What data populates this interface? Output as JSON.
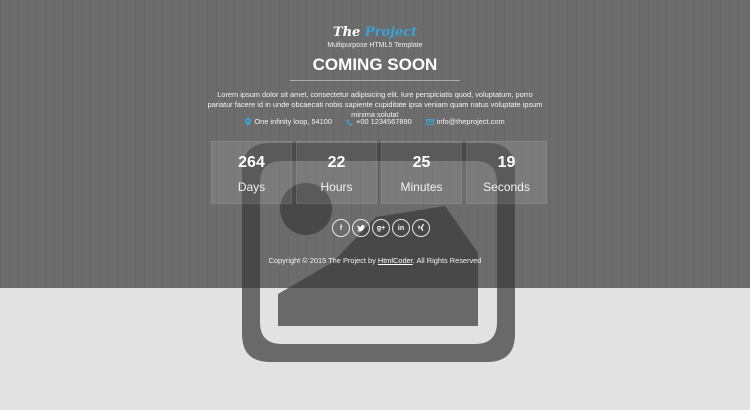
{
  "logo": {
    "part1": "The",
    "part2": "Project"
  },
  "tagline": "Multipurpose HTML5 Template",
  "title": "COMING SOON",
  "description": "Lorem ipsum dolor sit amet, consectetur adipisicing elit. Iure perspiciatis quod, voluptatum, porro pariatur facere id in unde obcaecati nobis sapiente cupiditate ipsa veniam quam natus voluptate ipsum minima soluta!",
  "contact": {
    "address": "One infinity loop, 54100",
    "phone": "+00 1234567890",
    "email": "info@theproject.com"
  },
  "countdown": [
    {
      "value": "264",
      "label": "Days"
    },
    {
      "value": "22",
      "label": "Hours"
    },
    {
      "value": "25",
      "label": "Minutes"
    },
    {
      "value": "19",
      "label": "Seconds"
    }
  ],
  "social": [
    {
      "icon": "facebook-icon",
      "glyph": "f"
    },
    {
      "icon": "twitter-icon",
      "glyph": ""
    },
    {
      "icon": "googleplus-icon",
      "glyph": "g+"
    },
    {
      "icon": "linkedin-icon",
      "glyph": "in"
    },
    {
      "icon": "xing-icon",
      "glyph": ""
    }
  ],
  "footer": {
    "prefix": "Copyright © 2015 The Project by ",
    "link": "HtmlCoder",
    "suffix": ". All Rights Reserved"
  },
  "colors": {
    "hero_background": "#6c6c6c",
    "page_background": "#e2e2e2",
    "accent": "#3aa4d8",
    "placeholder_overlay": "#3a3a3a"
  }
}
